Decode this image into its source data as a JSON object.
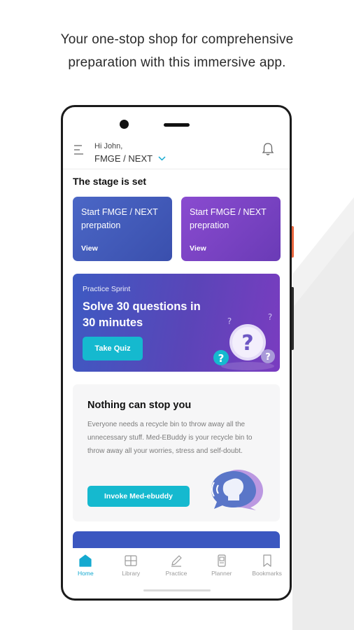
{
  "promo": {
    "headline_line1": "Your one-stop shop for comprehensive",
    "headline_line2": "preparation with this immersive app."
  },
  "header": {
    "greeting": "Hi John,",
    "exam": "FMGE / NEXT"
  },
  "section_title": "The stage is set",
  "stage_cards": [
    {
      "line1": "Start FMGE / NEXT",
      "line2": "prerpation",
      "link": "View"
    },
    {
      "line1": "Start FMGE / NEXT",
      "line2": "prepration",
      "link": "View"
    }
  ],
  "sprint": {
    "label": "Practice Sprint",
    "line1": "Solve 30 questions in",
    "line2": "30 minutes",
    "button": "Take Quiz"
  },
  "nothing": {
    "title": "Nothing can stop you",
    "description": "Everyone needs a recycle bin to throw away all the unnecessary stuff. Med-EBuddy is your recycle bin to throw away all your worries, stress and self-doubt.",
    "button": "Invoke Med-ebuddy"
  },
  "bottom_nav": [
    {
      "label": "Home",
      "icon": "home-icon",
      "active": true
    },
    {
      "label": "Library",
      "icon": "library-icon",
      "active": false
    },
    {
      "label": "Practice",
      "icon": "pencil-icon",
      "active": false
    },
    {
      "label": "Planner",
      "icon": "planner-icon",
      "active": false
    },
    {
      "label": "Bookmarks",
      "icon": "bookmark-icon",
      "active": false
    }
  ],
  "colors": {
    "accent": "#15b9cf",
    "stage_blue": "#4b67c6",
    "stage_purple": "#8a4bd0",
    "nav_active": "#14a9d0",
    "side_button": "#e8663d"
  }
}
